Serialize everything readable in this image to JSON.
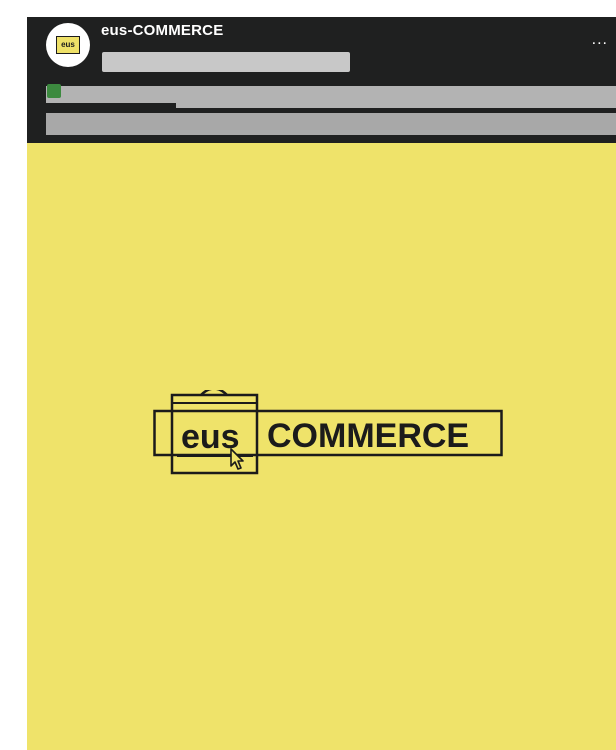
{
  "post": {
    "account_name": "eus-COMMERCE",
    "avatar_text": "eus",
    "more_label": "..."
  },
  "image": {
    "logo_text_left": "eus",
    "logo_text_right": "COMMERCE",
    "background_color": "#efe36a",
    "ink_color": "#1b1b1b"
  },
  "colors": {
    "header_bg": "#1f2020",
    "accent_green": "#3c8a3f"
  }
}
